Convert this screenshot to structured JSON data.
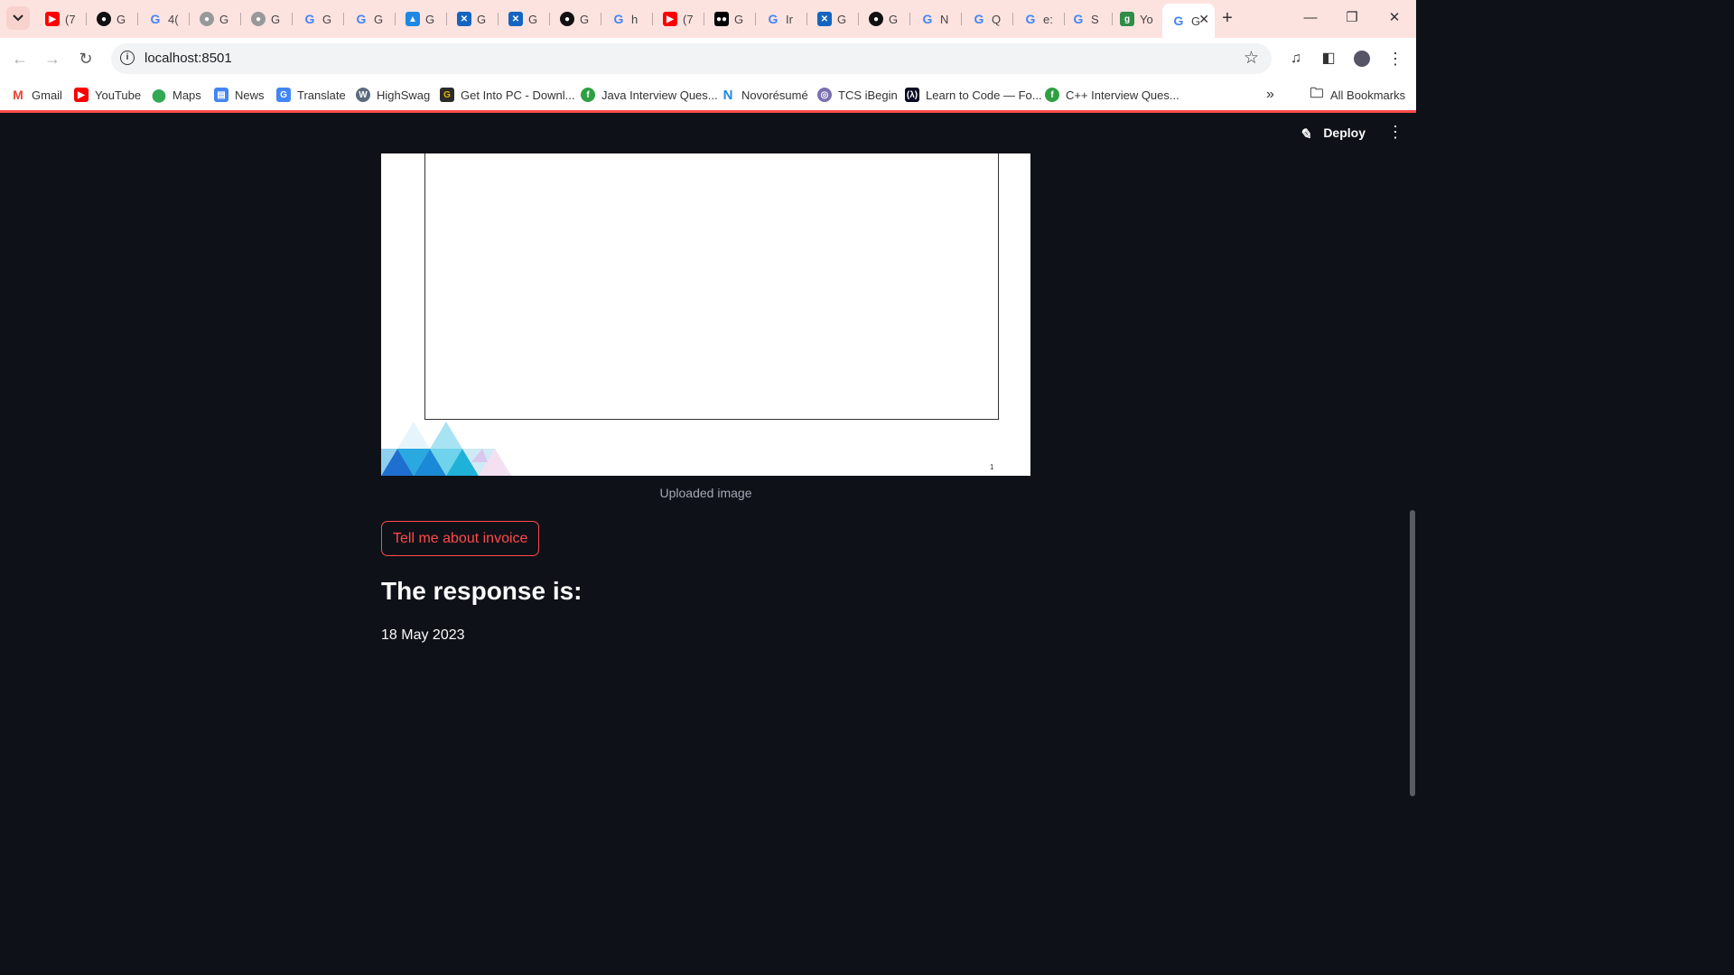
{
  "browser": {
    "tabs": [
      {
        "label": "(7",
        "icon": "youtube-icon"
      },
      {
        "label": "G",
        "icon": "github-icon"
      },
      {
        "label": "4(",
        "icon": "google-icon"
      },
      {
        "label": "G",
        "icon": "github-icon"
      },
      {
        "label": "G",
        "icon": "github-icon"
      },
      {
        "label": "G",
        "icon": "google-icon"
      },
      {
        "label": "G",
        "icon": "google-icon"
      },
      {
        "label": "G",
        "icon": "drive-icon"
      },
      {
        "label": "G",
        "icon": "confluence-icon"
      },
      {
        "label": "G",
        "icon": "confluence-icon"
      },
      {
        "label": "G",
        "icon": "github-icon"
      },
      {
        "label": "h",
        "icon": "google-icon"
      },
      {
        "label": "(7",
        "icon": "youtube-icon"
      },
      {
        "label": "G",
        "icon": "medium-icon"
      },
      {
        "label": "Ir",
        "icon": "google-icon"
      },
      {
        "label": "G",
        "icon": "confluence-icon"
      },
      {
        "label": "G",
        "icon": "github-icon"
      },
      {
        "label": "N",
        "icon": "google-icon"
      },
      {
        "label": "Q",
        "icon": "google-icon"
      },
      {
        "label": "e:",
        "icon": "google-icon"
      },
      {
        "label": "S",
        "icon": "google-icon"
      },
      {
        "label": "Yo",
        "icon": "gfg-icon"
      }
    ],
    "active_tab": {
      "label": "G",
      "icon": "google-icon"
    },
    "url": "localhost:8501",
    "bookmarks": [
      {
        "label": "Gmail",
        "icon": "gmail-icon"
      },
      {
        "label": "YouTube",
        "icon": "youtube-icon"
      },
      {
        "label": "Maps",
        "icon": "maps-icon"
      },
      {
        "label": "News",
        "icon": "news-icon"
      },
      {
        "label": "Translate",
        "icon": "translate-icon"
      },
      {
        "label": "HighSwag",
        "icon": "wordpress-icon"
      },
      {
        "label": "Get Into PC - Downl...",
        "icon": "getintopc-icon"
      },
      {
        "label": "Java Interview Ques...",
        "icon": "interview-icon"
      },
      {
        "label": "Novorésumé",
        "icon": "novoresume-icon"
      },
      {
        "label": "TCS iBegin",
        "icon": "tcs-icon"
      },
      {
        "label": "Learn to Code — Fo...",
        "icon": "freecodecamp-icon"
      },
      {
        "label": "C++ Interview Ques...",
        "icon": "interview-icon"
      }
    ],
    "all_bookmarks": "All Bookmarks"
  },
  "app": {
    "deploy_label": "Deploy",
    "caption": "Uploaded image",
    "page_number": "1",
    "button_label": "Tell me about invoice",
    "response_title": "The response is:",
    "response_text": "18 May 2023"
  },
  "colors": {
    "accent": "#ff4b4b",
    "background": "#0e1117",
    "tabstrip": "#fde3e0"
  }
}
